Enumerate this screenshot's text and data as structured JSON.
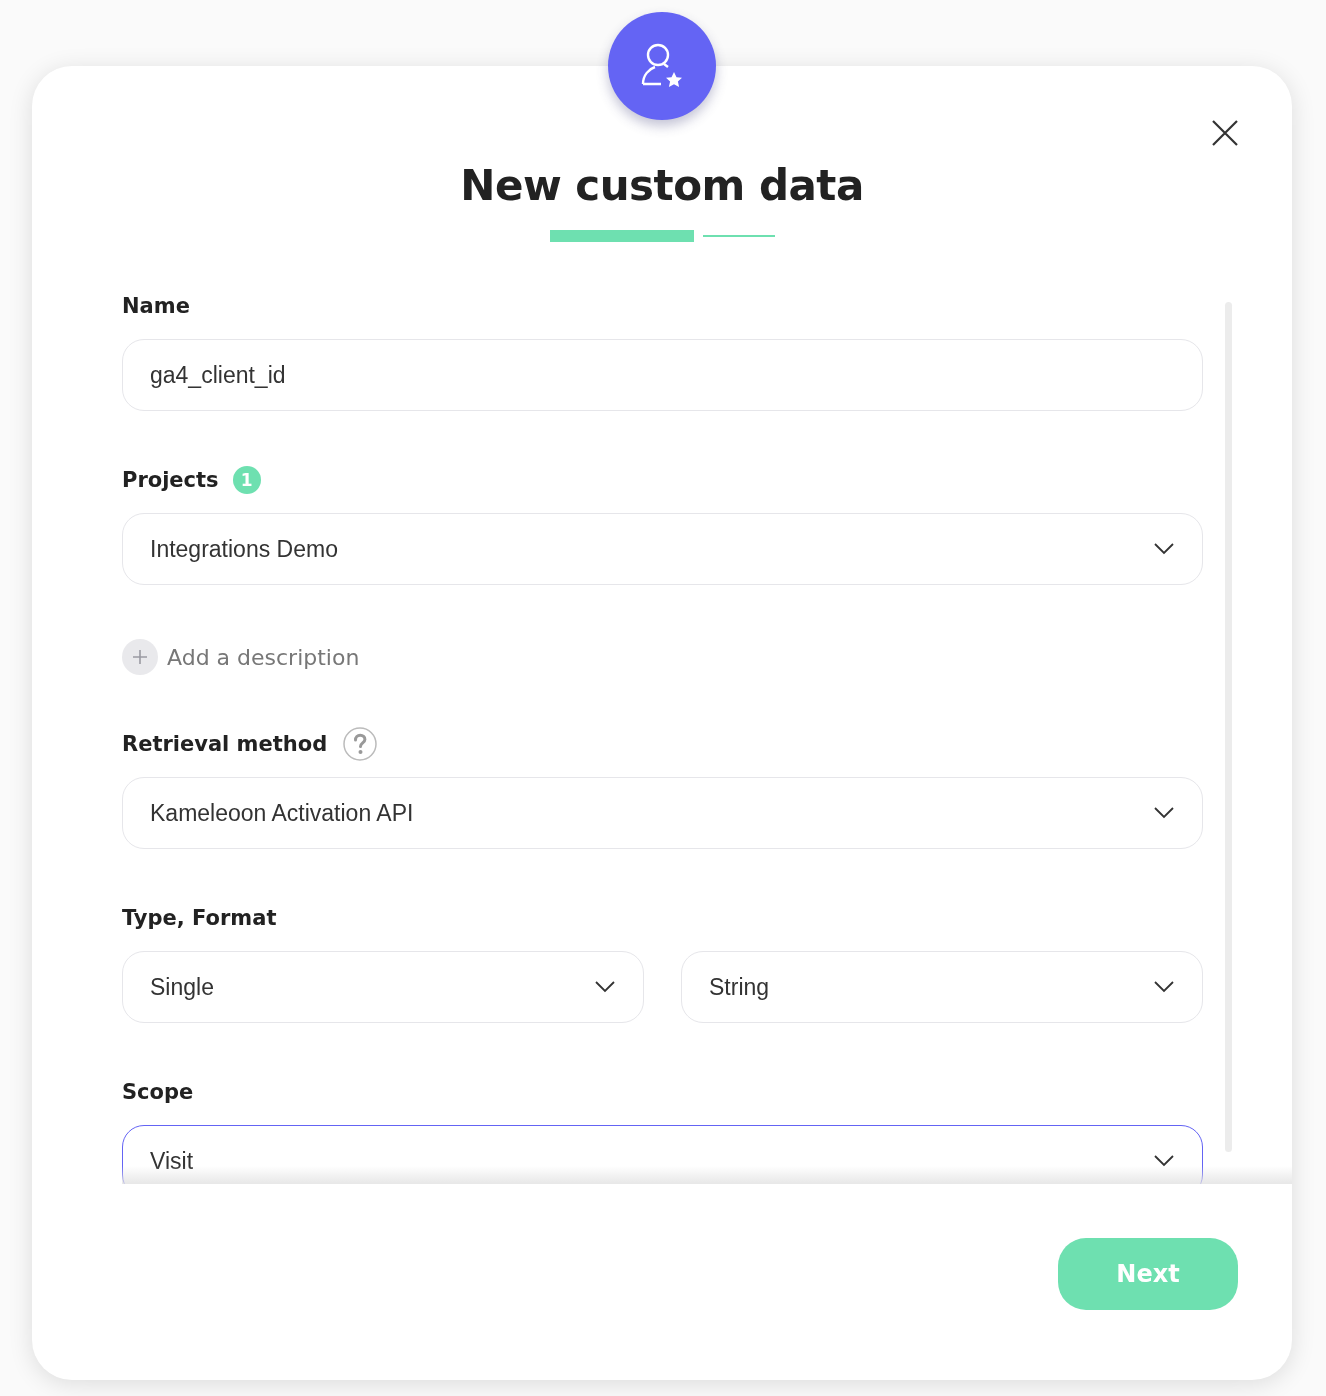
{
  "dialog": {
    "title": "New custom data",
    "steps": [
      {
        "selected": true
      },
      {
        "selected": false
      }
    ],
    "sections": [
      {
        "kind": "text",
        "label": "Name",
        "value": "ga4_client_id",
        "focused": false
      },
      {
        "kind": "select",
        "label": "Projects",
        "badge": "1",
        "value": "Integrations Demo",
        "focused": false
      },
      {
        "kind": "link",
        "label": "Add a description"
      },
      {
        "kind": "select",
        "label": "Retrieval method",
        "help": true,
        "value": "Kameleoon Activation API",
        "focused": false
      },
      {
        "kind": "pair",
        "label": "Type, Format",
        "values": [
          "Single",
          "String"
        ]
      },
      {
        "kind": "select",
        "label": "Scope",
        "value": "Visit",
        "focused": true
      }
    ],
    "next_button": "Next"
  }
}
